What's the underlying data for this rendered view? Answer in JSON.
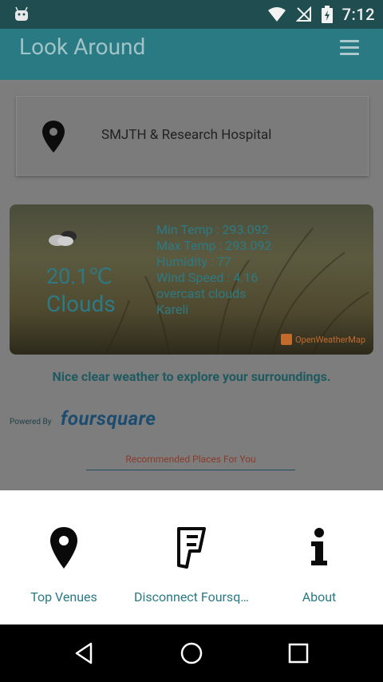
{
  "status_bar": {
    "time": "7:12"
  },
  "app_bar": {
    "title": "Look Around"
  },
  "location": {
    "name": "SMJTH & Research Hospital"
  },
  "weather": {
    "temp": "20.1℃",
    "condition": "Clouds",
    "details": [
      "Min Temp : 293.092",
      "Max Temp : 293.092",
      "Humidity : 77",
      "Wind Speed : 4.16",
      "overcast clouds",
      "Kareli"
    ],
    "provider": "OpenWeatherMap"
  },
  "message": "Nice clear weather to explore your surroundings.",
  "powered_by": "Powered By",
  "foursquare_logo": "foursquare",
  "recommended": "Recommended Places For You",
  "sheet": {
    "items": [
      {
        "label": "Top Venues",
        "icon": "map-pin-icon"
      },
      {
        "label": "Disconnect Foursq…",
        "icon": "foursquare-icon"
      },
      {
        "label": "About",
        "icon": "info-icon"
      }
    ]
  },
  "colors": {
    "accent": "#2a7a83",
    "status_bar": "#1f4d50",
    "nav_bar": "#000000"
  }
}
